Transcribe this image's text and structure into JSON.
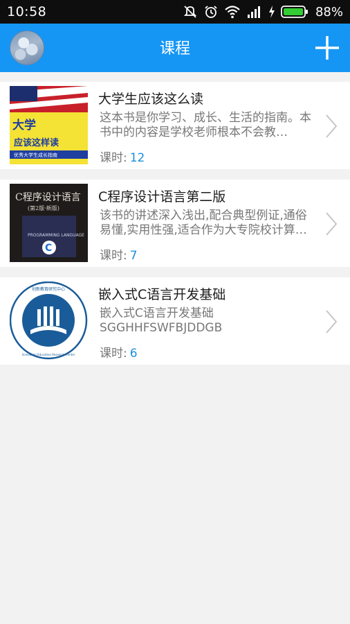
{
  "status_bar": {
    "time": "10:58",
    "battery": "88%",
    "icons": [
      "mute-icon",
      "alarm-icon",
      "wifi-icon",
      "signal-icon",
      "charging-icon",
      "battery-icon"
    ]
  },
  "header": {
    "title": "课程",
    "avatar_icon": "avatar-image",
    "add_icon": "plus-icon",
    "background": "#1596f5"
  },
  "courses": [
    {
      "title": "大学生应该这么读",
      "desc": "这本书是你学习、成长、生活的指南。本书中的内容是学校老师根本不会教…",
      "lessons_label": "课时:",
      "lessons": "12",
      "cover": {
        "big_text": "大学",
        "sub_text": "应该这样读",
        "band_text": "优秀大学生成长指南"
      }
    },
    {
      "title": "C程序设计语言第二版",
      "desc": "该书的讲述深入浅出,配合典型例证,通俗易懂,实用性强,适合作为大专院校计算…",
      "lessons_label": "课时:",
      "lessons": "7",
      "cover": {
        "big_text": "C程序设计语言",
        "sub_text": "(第2版·新版)",
        "band_text": "PROGRAMMING LANGUAGE"
      }
    },
    {
      "title": "嵌入式C语言开发基础",
      "desc": "嵌入式C语言开发基础 SGGHHFSWFBJDDGB",
      "lessons_label": "课时:",
      "lessons": "6",
      "cover": {
        "big_text": "创新教育研究中心",
        "sub_text": "Innovation Education Research Center",
        "band_text": ""
      }
    }
  ]
}
